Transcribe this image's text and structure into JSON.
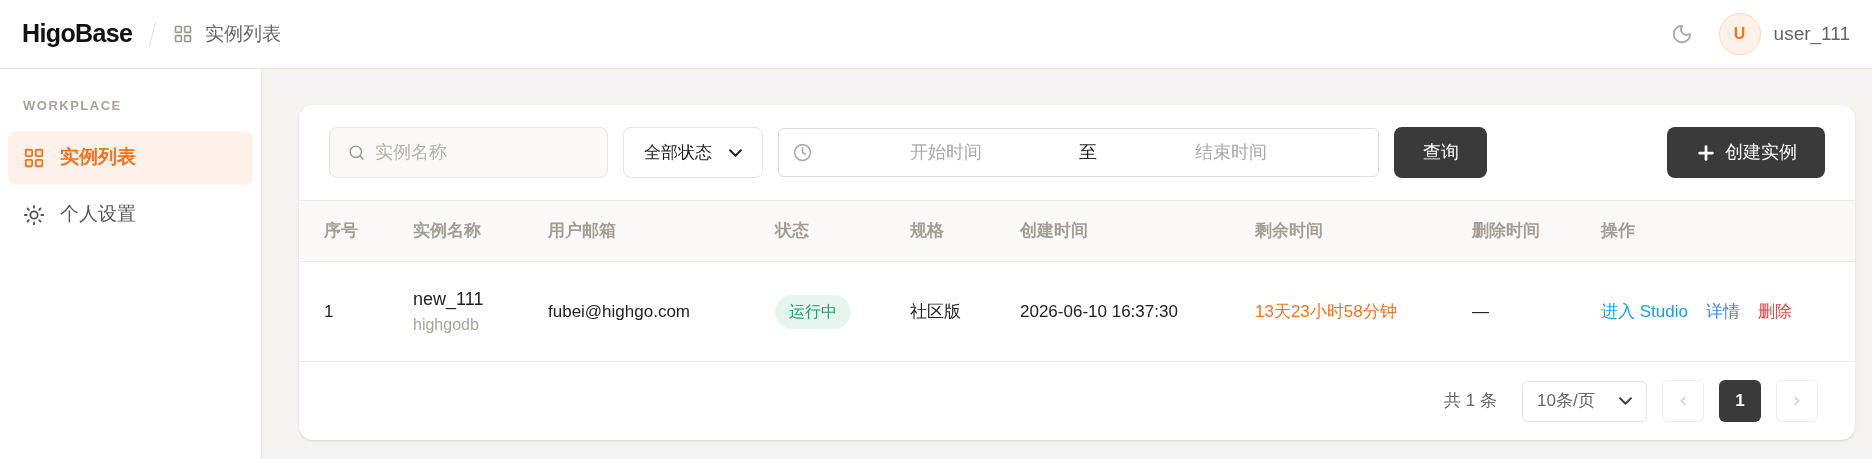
{
  "header": {
    "logo": "HigoBase",
    "breadcrumb": "实例列表",
    "avatar_initial": "U",
    "username": "user_111"
  },
  "sidebar": {
    "section": "WORKPLACE",
    "items": [
      {
        "label": "实例列表",
        "selected": true
      },
      {
        "label": "个人设置",
        "selected": false
      }
    ]
  },
  "filters": {
    "search_placeholder": "实例名称",
    "status_select": "全部状态",
    "start_placeholder": "开始时间",
    "range_separator": "至",
    "end_placeholder": "结束时间",
    "query_button": "查询",
    "create_button": "创建实例"
  },
  "table": {
    "columns": [
      "序号",
      "实例名称",
      "用户邮箱",
      "状态",
      "规格",
      "创建时间",
      "剩余时间",
      "删除时间",
      "操作"
    ],
    "rows": [
      {
        "index": "1",
        "name": "new_111",
        "db": "highgodb",
        "email": "fubei@highgo.com",
        "status": {
          "label": "运行中",
          "kind": "running"
        },
        "spec": "社区版",
        "created": "2026-06-10 16:37:30",
        "remaining": "13天23小时58分钟",
        "deleted": "—",
        "actions": [
          {
            "label": "进入 Studio",
            "kind": "studio"
          },
          {
            "label": "详情",
            "kind": "detail"
          },
          {
            "label": "删除",
            "kind": "delete"
          }
        ]
      }
    ]
  },
  "pagination": {
    "total": "共 1 条",
    "page_size": "10条/页",
    "pages": [
      {
        "label": "1",
        "selected": true
      }
    ]
  }
}
